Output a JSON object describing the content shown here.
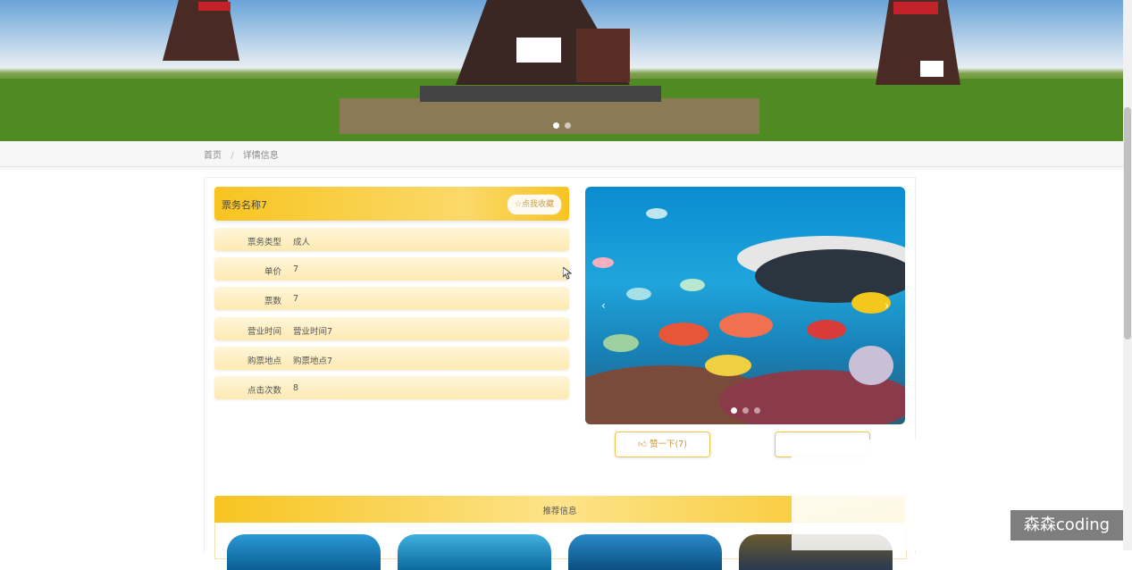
{
  "banner": {
    "slide_count": 2,
    "active_slide": 1
  },
  "breadcrumb": {
    "home": "首页",
    "separator": "/",
    "current": "详情信息"
  },
  "detail": {
    "title": "票务名称7",
    "favorite_button": "☆点我收藏",
    "fields": [
      {
        "label": "票务类型",
        "value": "成人"
      },
      {
        "label": "单价",
        "value": "7"
      },
      {
        "label": "票数",
        "value": "7"
      },
      {
        "label": "营业时间",
        "value": "营业时间7"
      },
      {
        "label": "购票地点",
        "value": "购票地点7"
      },
      {
        "label": "点击次数",
        "value": "8"
      }
    ]
  },
  "carousel": {
    "prev": "‹",
    "next": "›",
    "slide_count": 3,
    "active_slide": 1
  },
  "actions": {
    "like_label": "赞一下(7)",
    "like_icon": "thumbs-up-icon"
  },
  "recommend": {
    "title": "推荐信息"
  },
  "watermark": "森森coding",
  "colors": {
    "accent": "#f7c421",
    "row_bg": "#fde9b2"
  }
}
